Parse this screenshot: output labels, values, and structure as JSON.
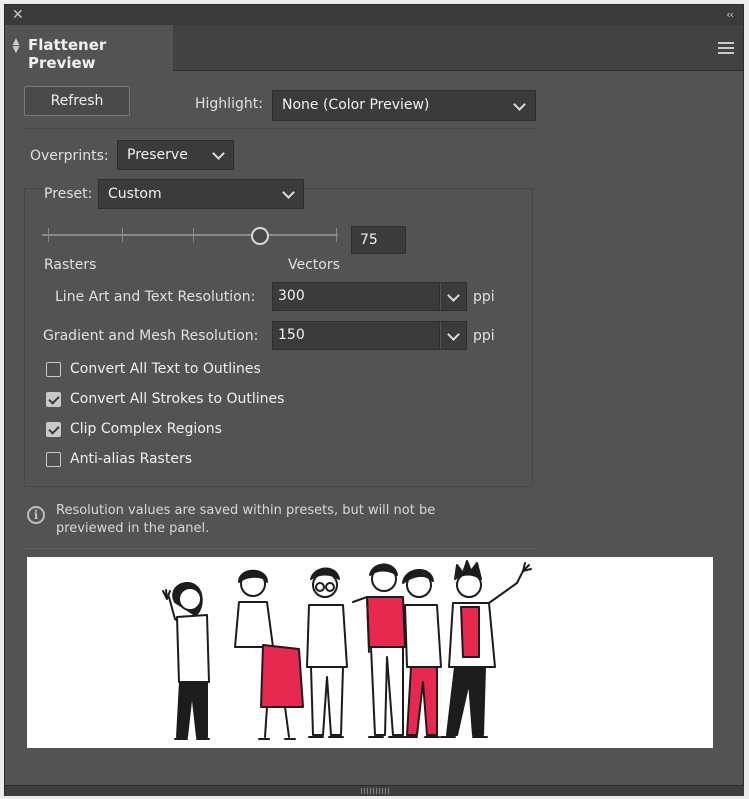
{
  "window": {
    "close_glyph": "✕",
    "collapse_glyph": "‹‹"
  },
  "tab": {
    "title": "Flattener Preview",
    "menu_icon": "hamburger-icon"
  },
  "refresh_label": "Refresh",
  "highlight": {
    "label": "Highlight:",
    "value": "None (Color Preview)"
  },
  "overprints": {
    "label": "Overprints:",
    "value": "Preserve"
  },
  "preset": {
    "label": "Preset:",
    "value": "Custom"
  },
  "slider": {
    "value": "75",
    "level_percent": 75,
    "left_label": "Rasters",
    "right_label": "Vectors"
  },
  "line_art": {
    "label": "Line Art and Text Resolution:",
    "value": "300",
    "unit": "ppi"
  },
  "gradient": {
    "label": "Gradient and Mesh Resolution:",
    "value": "150",
    "unit": "ppi"
  },
  "checkboxes": [
    {
      "label": "Convert All Text to Outlines",
      "checked": false
    },
    {
      "label": "Convert All Strokes to Outlines",
      "checked": true
    },
    {
      "label": "Clip Complex Regions",
      "checked": true
    },
    {
      "label": "Anti-alias Rasters",
      "checked": false
    }
  ],
  "info": {
    "icon": "info-icon",
    "line1": "Resolution values are saved within presets, but will not be",
    "line2": "previewed in the panel."
  },
  "colors": {
    "panel": "#535353",
    "accent_red": "#e8294f",
    "preview_bg": "#ffffff"
  }
}
